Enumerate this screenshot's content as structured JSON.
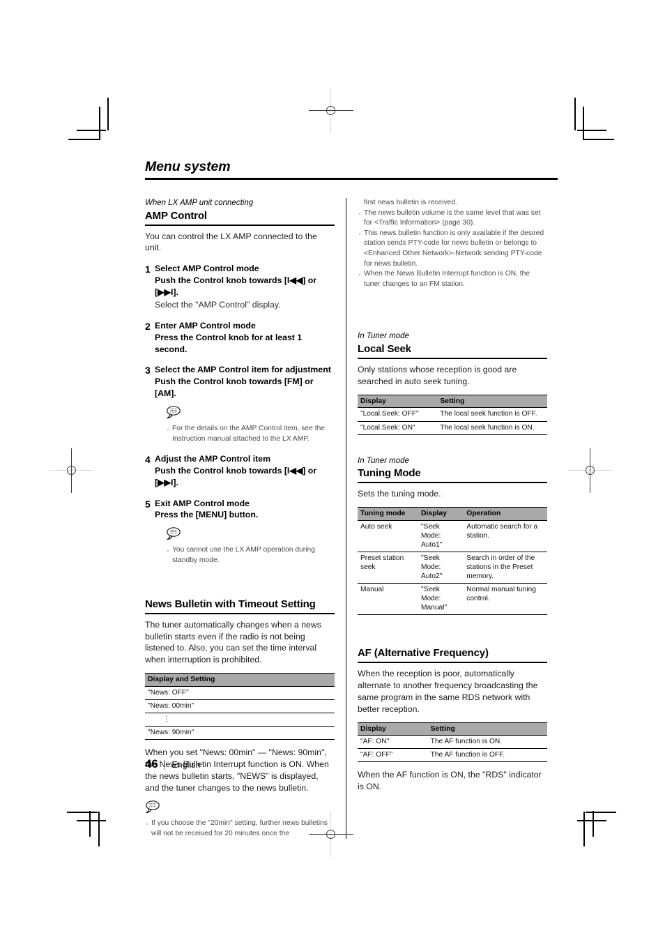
{
  "document": {
    "title": "Menu system",
    "footer": {
      "page_number": "46",
      "separator": "|",
      "language": "English"
    }
  },
  "left_column": {
    "amp_control": {
      "kicker": "When LX AMP unit connecting",
      "heading": "AMP Control",
      "intro": "You can control the LX AMP connected to the unit.",
      "steps": [
        {
          "num": "1",
          "bold": "Select AMP Control mode",
          "bold2": "Push the Control knob towards [I◀◀] or [▶▶I].",
          "sub": "Select the \"AMP Control\" display."
        },
        {
          "num": "2",
          "bold": "Enter AMP Control mode",
          "bold2": "Press the Control knob for at least 1 second.",
          "sub": ""
        },
        {
          "num": "3",
          "bold": "Select the AMP Control item for adjustment",
          "bold2": "Push the Control knob towards [FM] or [AM].",
          "sub": "",
          "note_icon": "note-bubble-icon",
          "notes": [
            "For the details on the AMP Control item, see the Instruction manual attached to the LX AMP."
          ]
        },
        {
          "num": "4",
          "bold": "Adjust the AMP Control item",
          "bold2": "Push the Control knob towards [I◀◀] or [▶▶I].",
          "sub": ""
        },
        {
          "num": "5",
          "bold": "Exit AMP Control mode",
          "bold2": "Press the [MENU] button.",
          "sub": "",
          "note_icon": "note-bubble-icon",
          "notes": [
            "You cannot use the LX AMP operation during standby mode."
          ]
        }
      ]
    },
    "news_bulletin": {
      "heading": "News Bulletin with Timeout Setting",
      "intro": "The tuner automatically changes when a news bulletin starts even if the radio is not being listened to. Also, you can set the time interval when interruption is prohibited.",
      "table": {
        "headers": [
          "Display and Setting"
        ],
        "rows": [
          [
            "\"News: OFF\""
          ],
          [
            "\"News: 00min\""
          ],
          [
            "⋮"
          ],
          [
            "\"News: 90min\""
          ]
        ]
      },
      "after_table": "When you set \"News: 00min\" — \"News: 90min\", the News Bulletin Interrupt function is ON. When the news bulletin starts, \"NEWS\" is displayed, and the tuner changes to the news bulletin.",
      "note_icon": "note-bubble-icon",
      "notes": [
        "If you choose the \"20min\" setting, further news bulletins will not be received for 20 minutes once the"
      ]
    }
  },
  "right_column": {
    "continued_notes": {
      "first_line": "first news bulletin is received.",
      "items": [
        "The news bulletin volume is the same level that was set for <Traffic Information> (page 30).",
        "This news bulletin function is only available if the desired station sends PTY-code for news bulletin or belongs to <Enhanced Other Network>-Network sending PTY-code for news bulletin.",
        "When the News Bulletin Interrupt function is ON, the tuner changes to an FM station."
      ]
    },
    "local_seek": {
      "kicker": "In Tuner mode",
      "heading": "Local Seek",
      "intro": "Only stations whose reception is good are searched in auto seek tuning.",
      "table": {
        "headers": [
          "Display",
          "Setting"
        ],
        "rows": [
          [
            "\"Local.Seek: OFF\"",
            "The local seek function is OFF."
          ],
          [
            "\"Local.Seek: ON\"",
            "The local seek function is ON."
          ]
        ]
      }
    },
    "tuning_mode": {
      "kicker": "In Tuner mode",
      "heading": "Tuning Mode",
      "intro": "Sets the tuning mode.",
      "table": {
        "headers": [
          "Tuning mode",
          "Display",
          "Operation"
        ],
        "rows": [
          [
            "Auto seek",
            "\"Seek Mode: Auto1\"",
            "Automatic search for a station."
          ],
          [
            "Preset station seek",
            "\"Seek Mode: Auto2\"",
            "Search in order of the stations in the Preset memory."
          ],
          [
            "Manual",
            "\"Seek Mode: Manual\"",
            "Normal manual tuning control."
          ]
        ]
      }
    },
    "af": {
      "heading": "AF (Alternative Frequency)",
      "intro": "When the reception is poor, automatically alternate to another frequency broadcasting the same program in the same RDS network with better reception.",
      "table": {
        "headers": [
          "Display",
          "Setting"
        ],
        "rows": [
          [
            "\"AF: ON\"",
            "The AF function is ON."
          ],
          [
            "\"AF: OFF\"",
            "The AF function is OFF."
          ]
        ]
      },
      "after_table": "When the AF function is ON, the \"RDS\" indicator is ON."
    }
  }
}
